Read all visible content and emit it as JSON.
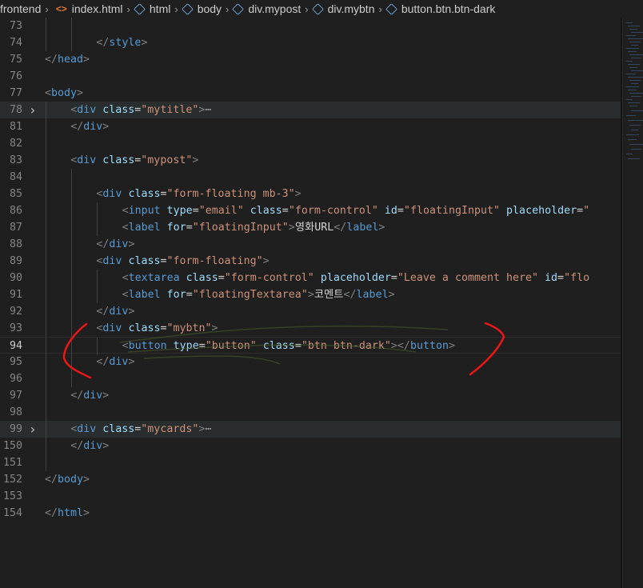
{
  "breadcrumb": {
    "items": [
      {
        "label": "frontend",
        "icon": "none"
      },
      {
        "label": "index.html",
        "icon": "html-file-icon"
      },
      {
        "label": "html",
        "icon": "cube-icon"
      },
      {
        "label": "body",
        "icon": "cube-icon"
      },
      {
        "label": "div.mypost",
        "icon": "cube-icon"
      },
      {
        "label": "div.mybtn",
        "icon": "cube-icon"
      },
      {
        "label": "button.btn.btn-dark",
        "icon": "cube-icon"
      }
    ]
  },
  "editor": {
    "current_line": "94",
    "lines": [
      {
        "n": "73",
        "indent": 2,
        "fold": false,
        "tokens": []
      },
      {
        "n": "74",
        "indent": 2,
        "fold": false,
        "tokens": [
          [
            "p",
            "</"
          ],
          [
            "tag",
            "style"
          ],
          [
            "p",
            ">"
          ]
        ]
      },
      {
        "n": "75",
        "indent": 0,
        "fold": false,
        "tokens": [
          [
            "p",
            "</"
          ],
          [
            "tag",
            "head"
          ],
          [
            "p",
            ">"
          ]
        ]
      },
      {
        "n": "76",
        "indent": 0,
        "fold": false,
        "tokens": []
      },
      {
        "n": "77",
        "indent": 0,
        "fold": false,
        "tokens": [
          [
            "p",
            "<"
          ],
          [
            "tag",
            "body"
          ],
          [
            "p",
            ">"
          ]
        ]
      },
      {
        "n": "78",
        "indent": 1,
        "fold": true,
        "tokens": [
          [
            "p",
            "<"
          ],
          [
            "tag",
            "div"
          ],
          [
            "x",
            " "
          ],
          [
            "attr",
            "class"
          ],
          [
            "x",
            "="
          ],
          [
            "str",
            "\"mytitle\""
          ],
          [
            "p",
            ">"
          ],
          [
            "ell",
            "⋯"
          ]
        ]
      },
      {
        "n": "81",
        "indent": 1,
        "fold": false,
        "tokens": [
          [
            "p",
            "</"
          ],
          [
            "tag",
            "div"
          ],
          [
            "p",
            ">"
          ]
        ]
      },
      {
        "n": "82",
        "indent": 1,
        "fold": false,
        "tokens": []
      },
      {
        "n": "83",
        "indent": 1,
        "fold": false,
        "tokens": [
          [
            "p",
            "<"
          ],
          [
            "tag",
            "div"
          ],
          [
            "x",
            " "
          ],
          [
            "attr",
            "class"
          ],
          [
            "x",
            "="
          ],
          [
            "str",
            "\"mypost\""
          ],
          [
            "p",
            ">"
          ]
        ]
      },
      {
        "n": "84",
        "indent": 2,
        "fold": false,
        "tokens": []
      },
      {
        "n": "85",
        "indent": 2,
        "fold": false,
        "tokens": [
          [
            "p",
            "<"
          ],
          [
            "tag",
            "div"
          ],
          [
            "x",
            " "
          ],
          [
            "attr",
            "class"
          ],
          [
            "x",
            "="
          ],
          [
            "str",
            "\"form-floating mb-3\""
          ],
          [
            "p",
            ">"
          ]
        ]
      },
      {
        "n": "86",
        "indent": 3,
        "fold": false,
        "tokens": [
          [
            "p",
            "<"
          ],
          [
            "tag",
            "input"
          ],
          [
            "x",
            " "
          ],
          [
            "attr",
            "type"
          ],
          [
            "x",
            "="
          ],
          [
            "str",
            "\"email\""
          ],
          [
            "x",
            " "
          ],
          [
            "attr",
            "class"
          ],
          [
            "x",
            "="
          ],
          [
            "str",
            "\"form-control\""
          ],
          [
            "x",
            " "
          ],
          [
            "attr",
            "id"
          ],
          [
            "x",
            "="
          ],
          [
            "str",
            "\"floatingInput\""
          ],
          [
            "x",
            " "
          ],
          [
            "attr",
            "placeholder"
          ],
          [
            "x",
            "="
          ],
          [
            "str",
            "\""
          ]
        ]
      },
      {
        "n": "87",
        "indent": 3,
        "fold": false,
        "tokens": [
          [
            "p",
            "<"
          ],
          [
            "tag",
            "label"
          ],
          [
            "x",
            " "
          ],
          [
            "attr",
            "for"
          ],
          [
            "x",
            "="
          ],
          [
            "str",
            "\"floatingInput\""
          ],
          [
            "p",
            ">"
          ],
          [
            "x",
            "영화URL"
          ],
          [
            "p",
            "</"
          ],
          [
            "tag",
            "label"
          ],
          [
            "p",
            ">"
          ]
        ]
      },
      {
        "n": "88",
        "indent": 2,
        "fold": false,
        "tokens": [
          [
            "p",
            "</"
          ],
          [
            "tag",
            "div"
          ],
          [
            "p",
            ">"
          ]
        ]
      },
      {
        "n": "89",
        "indent": 2,
        "fold": false,
        "tokens": [
          [
            "p",
            "<"
          ],
          [
            "tag",
            "div"
          ],
          [
            "x",
            " "
          ],
          [
            "attr",
            "class"
          ],
          [
            "x",
            "="
          ],
          [
            "str",
            "\"form-floating\""
          ],
          [
            "p",
            ">"
          ]
        ]
      },
      {
        "n": "90",
        "indent": 3,
        "fold": false,
        "tokens": [
          [
            "p",
            "<"
          ],
          [
            "tag",
            "textarea"
          ],
          [
            "x",
            " "
          ],
          [
            "attr",
            "class"
          ],
          [
            "x",
            "="
          ],
          [
            "str",
            "\"form-control\""
          ],
          [
            "x",
            " "
          ],
          [
            "attr",
            "placeholder"
          ],
          [
            "x",
            "="
          ],
          [
            "str",
            "\"Leave a comment here\""
          ],
          [
            "x",
            " "
          ],
          [
            "attr",
            "id"
          ],
          [
            "x",
            "="
          ],
          [
            "str",
            "\"flo"
          ]
        ]
      },
      {
        "n": "91",
        "indent": 3,
        "fold": false,
        "tokens": [
          [
            "p",
            "<"
          ],
          [
            "tag",
            "label"
          ],
          [
            "x",
            " "
          ],
          [
            "attr",
            "for"
          ],
          [
            "x",
            "="
          ],
          [
            "str",
            "\"floatingTextarea\""
          ],
          [
            "p",
            ">"
          ],
          [
            "x",
            "코멘트"
          ],
          [
            "p",
            "</"
          ],
          [
            "tag",
            "label"
          ],
          [
            "p",
            ">"
          ]
        ]
      },
      {
        "n": "92",
        "indent": 2,
        "fold": false,
        "tokens": [
          [
            "p",
            "</"
          ],
          [
            "tag",
            "div"
          ],
          [
            "p",
            ">"
          ]
        ]
      },
      {
        "n": "93",
        "indent": 2,
        "fold": false,
        "tokens": [
          [
            "p",
            "<"
          ],
          [
            "tag",
            "div"
          ],
          [
            "x",
            " "
          ],
          [
            "attr",
            "class"
          ],
          [
            "x",
            "="
          ],
          [
            "str",
            "\"mybtn\""
          ],
          [
            "p",
            ">"
          ]
        ]
      },
      {
        "n": "94",
        "indent": 3,
        "fold": false,
        "tokens": [
          [
            "p",
            "<"
          ],
          [
            "tag",
            "button"
          ],
          [
            "x",
            " "
          ],
          [
            "attr",
            "type"
          ],
          [
            "x",
            "="
          ],
          [
            "str",
            "\"button\""
          ],
          [
            "x",
            " "
          ],
          [
            "attr",
            "class"
          ],
          [
            "x",
            "="
          ],
          [
            "str",
            "\"btn btn-dark\""
          ],
          [
            "p",
            "></"
          ],
          [
            "tag",
            "button"
          ],
          [
            "p",
            ">"
          ]
        ]
      },
      {
        "n": "95",
        "indent": 2,
        "fold": false,
        "tokens": [
          [
            "p",
            "</"
          ],
          [
            "tag",
            "div"
          ],
          [
            "p",
            ">"
          ]
        ]
      },
      {
        "n": "96",
        "indent": 2,
        "fold": false,
        "tokens": []
      },
      {
        "n": "97",
        "indent": 1,
        "fold": false,
        "tokens": [
          [
            "p",
            "</"
          ],
          [
            "tag",
            "div"
          ],
          [
            "p",
            ">"
          ]
        ]
      },
      {
        "n": "98",
        "indent": 1,
        "fold": false,
        "tokens": []
      },
      {
        "n": "99",
        "indent": 1,
        "fold": true,
        "tokens": [
          [
            "p",
            "<"
          ],
          [
            "tag",
            "div"
          ],
          [
            "x",
            " "
          ],
          [
            "attr",
            "class"
          ],
          [
            "x",
            "="
          ],
          [
            "str",
            "\"mycards\""
          ],
          [
            "p",
            ">"
          ],
          [
            "ell",
            "⋯"
          ]
        ]
      },
      {
        "n": "150",
        "indent": 1,
        "fold": false,
        "tokens": [
          [
            "p",
            "</"
          ],
          [
            "tag",
            "div"
          ],
          [
            "p",
            ">"
          ]
        ]
      },
      {
        "n": "151",
        "indent": 1,
        "fold": false,
        "tokens": []
      },
      {
        "n": "152",
        "indent": 0,
        "fold": false,
        "tokens": [
          [
            "p",
            "</"
          ],
          [
            "tag",
            "body"
          ],
          [
            "p",
            ">"
          ]
        ]
      },
      {
        "n": "153",
        "indent": 0,
        "fold": false,
        "tokens": []
      },
      {
        "n": "154",
        "indent": 0,
        "fold": false,
        "tokens": [
          [
            "p",
            "</"
          ],
          [
            "tag",
            "html"
          ],
          [
            "p",
            ">"
          ]
        ]
      }
    ]
  },
  "colors": {
    "background": "#1f1f1f",
    "tag": "#569cd6",
    "attribute": "#9cdcfe",
    "string": "#ce9178",
    "punctuation": "#808080",
    "annotation_red": "#e81818"
  }
}
